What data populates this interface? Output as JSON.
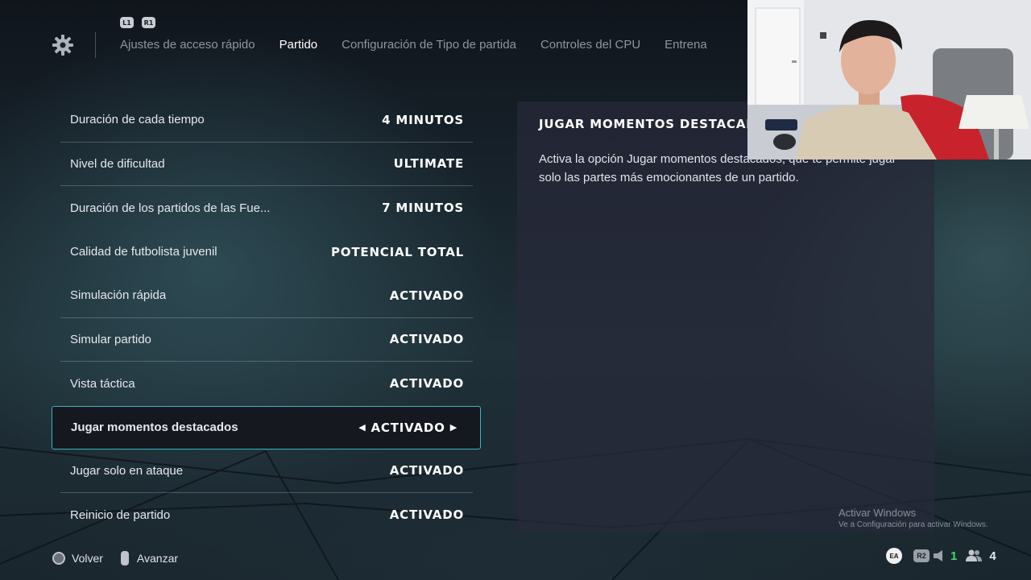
{
  "header": {
    "bumper_left": "L1",
    "bumper_right": "R1",
    "tabs": [
      {
        "label": "Ajustes de acceso rápido"
      },
      {
        "label": "Partido"
      },
      {
        "label": "Configuración de Tipo de partida"
      },
      {
        "label": "Controles del CPU"
      },
      {
        "label": "Entrena"
      }
    ],
    "active_tab": "Partido"
  },
  "settings": {
    "rows": [
      {
        "label": "Duración de cada tiempo",
        "value": "4 MINUTOS"
      },
      {
        "label": "Nivel de dificultad",
        "value": "ULTIMATE"
      },
      {
        "label": "Duración de los partidos de las Fue...",
        "value": "7 MINUTOS"
      },
      {
        "label": "Calidad de futbolista juvenil",
        "value": "POTENCIAL TOTAL"
      },
      {
        "label": "Simulación rápida",
        "value": "ACTIVADO"
      },
      {
        "label": "Simular partido",
        "value": "ACTIVADO"
      },
      {
        "label": "Vista táctica",
        "value": "ACTIVADO"
      },
      {
        "label": "Jugar momentos destacados",
        "value": "ACTIVADO",
        "selected": true
      },
      {
        "label": "Jugar solo en ataque",
        "value": "ACTIVADO"
      },
      {
        "label": "Reinicio de partido",
        "value": "ACTIVADO"
      }
    ]
  },
  "description": {
    "title": "JUGAR MOMENTOS DESTACADOS",
    "text": "Activa la opción Jugar momentos destacados, que te permite jugar solo las partes más emocionantes de un partido."
  },
  "watermark": {
    "line1": "Activar Windows",
    "line2": "Ve a Configuración para activar Windows."
  },
  "footer": {
    "back_label": "Volver",
    "advance_label": "Avanzar",
    "ea_label": "EA",
    "r2_label": "R2",
    "green_count": "1",
    "players_count": "4"
  },
  "colors": {
    "accent": "#35b6c2",
    "green": "#3ddc6e"
  },
  "icons": [
    "gear-icon",
    "circle-button-icon",
    "stick-icon",
    "ea-icon",
    "r2-icon",
    "mute-icon",
    "players-icon",
    "arrow-left-icon",
    "arrow-right-icon"
  ]
}
